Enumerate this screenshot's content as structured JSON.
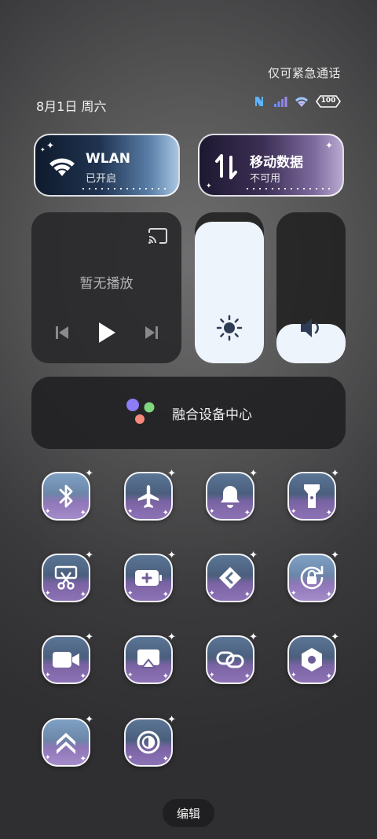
{
  "status": {
    "emergency_text": "仅可紧急通话",
    "date": "8月1日 周六",
    "battery_level": "100",
    "icons": [
      "nfc-icon",
      "signal-icon",
      "wifi-icon",
      "battery-icon"
    ]
  },
  "connectivity": {
    "wlan": {
      "title": "WLAN",
      "subtitle": "已开启",
      "icon": "wifi-icon"
    },
    "mobile": {
      "title": "移动数据",
      "subtitle": "不可用",
      "icon": "data-arrows-icon"
    }
  },
  "media": {
    "empty_text": "暂无播放",
    "icons": [
      "cast-icon",
      "previous-icon",
      "play-icon",
      "next-icon"
    ]
  },
  "sliders": {
    "brightness": {
      "level_percent": 94,
      "icon": "sun-icon"
    },
    "volume": {
      "level_percent": 26,
      "icon": "speaker-icon"
    }
  },
  "device_center": {
    "label": "融合设备中心"
  },
  "toggles": [
    {
      "name": "bluetooth-toggle",
      "icon": "bluetooth-icon",
      "active": true
    },
    {
      "name": "airplane-mode-toggle",
      "icon": "airplane-icon",
      "active": false
    },
    {
      "name": "ring-mode-toggle",
      "icon": "bell-icon",
      "active": false
    },
    {
      "name": "flashlight-toggle",
      "icon": "flashlight-icon",
      "active": false
    },
    {
      "name": "screenshot-toggle",
      "icon": "screenshot-scissors-icon",
      "active": false
    },
    {
      "name": "battery-saver-toggle",
      "icon": "battery-plus-icon",
      "active": false
    },
    {
      "name": "share-toggle",
      "icon": "share-arrows-icon",
      "active": false
    },
    {
      "name": "rotation-lock-toggle",
      "icon": "rotation-lock-icon",
      "active": true
    },
    {
      "name": "screen-record-toggle",
      "icon": "video-camera-icon",
      "active": false
    },
    {
      "name": "screen-cast-toggle",
      "icon": "airplay-icon",
      "active": false
    },
    {
      "name": "link-toggle",
      "icon": "link-icon",
      "active": false
    },
    {
      "name": "settings-toggle",
      "icon": "hexagon-nut-icon",
      "active": false
    },
    {
      "name": "performance-toggle",
      "icon": "double-chevron-up-icon",
      "active": true
    },
    {
      "name": "dark-mode-toggle",
      "icon": "contrast-icon",
      "active": false
    }
  ],
  "edit": {
    "label": "编辑"
  },
  "colors": {
    "accent_blue": "#7fa1c4",
    "accent_purple": "#8d73b6",
    "slider_fill": "#eef4fb"
  }
}
